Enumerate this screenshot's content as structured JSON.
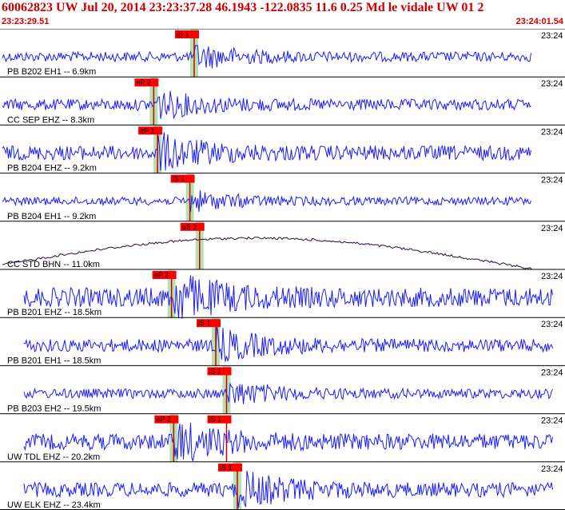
{
  "header": {
    "title": "60062823 UW Jul 20, 2014 23:23:37.28    46.1943 -122.0835 11.6 0.25 Md le vidale UW 01    2",
    "start_time": "23:23:29.51",
    "end_time": "23:24:01.54"
  },
  "time_tick_label": "23:24",
  "colors": {
    "trace": "#1a1aff",
    "trace_dark": "#2a0a3a",
    "pick_box": "#ff0000",
    "pick_line": "#cc0000",
    "highlight": "#b7e0b0",
    "title": "#cc0000"
  },
  "traces": [
    {
      "label": "PB B202 EH1 -- 6.9km",
      "amp": 6,
      "color": "trace",
      "picks": [
        {
          "text": "iS 1",
          "frac": 0.36,
          "hl": true
        }
      ]
    },
    {
      "label": "CC SEP EHZ -- 8.3km",
      "amp": 7,
      "color": "trace",
      "picks": [
        {
          "text": "eP 2",
          "frac": 0.285,
          "hl": true
        }
      ]
    },
    {
      "label": "PB B204 EHZ -- 9.2km",
      "amp": 9,
      "color": "trace",
      "picks": [
        {
          "text": "eP 1",
          "frac": 0.292,
          "hl": true
        }
      ]
    },
    {
      "label": "PB B204 EH1 -- 9.2km",
      "amp": 5,
      "color": "trace",
      "picks": [
        {
          "text": "iS 1",
          "frac": 0.352,
          "hl": true
        }
      ]
    },
    {
      "label": "CC STD BHN -- 11.0km",
      "amp": 3,
      "color": "trace_dark",
      "picks": [
        {
          "text": "eS 2",
          "frac": 0.37,
          "hl": true
        }
      ]
    },
    {
      "label": "PB B201 EHZ -- 18.5km",
      "amp": 12,
      "color": "trace",
      "picks": [
        {
          "text": "eP 2",
          "frac": 0.318,
          "hl": true
        }
      ]
    },
    {
      "label": "PB B201 EH1 -- 18.5km",
      "amp": 8,
      "color": "trace",
      "picks": [
        {
          "text": "iS 1",
          "frac": 0.4,
          "hl": true
        }
      ]
    },
    {
      "label": "PB B203 EH2 -- 19.5km",
      "amp": 6,
      "color": "trace",
      "picks": [
        {
          "text": "iS 1",
          "frac": 0.42,
          "hl": true
        }
      ]
    },
    {
      "label": "UW TDL EHZ -- 20.2km",
      "amp": 10,
      "color": "trace",
      "picks": [
        {
          "text": "eP 2",
          "frac": 0.322,
          "hl": true
        },
        {
          "text": "iS 1",
          "frac": 0.42,
          "hl": false
        }
      ]
    },
    {
      "label": "UW ELK EHZ -- 23.4km",
      "amp": 9,
      "color": "trace",
      "picks": [
        {
          "text": "iS 1",
          "frac": 0.44,
          "hl": true
        }
      ]
    }
  ]
}
